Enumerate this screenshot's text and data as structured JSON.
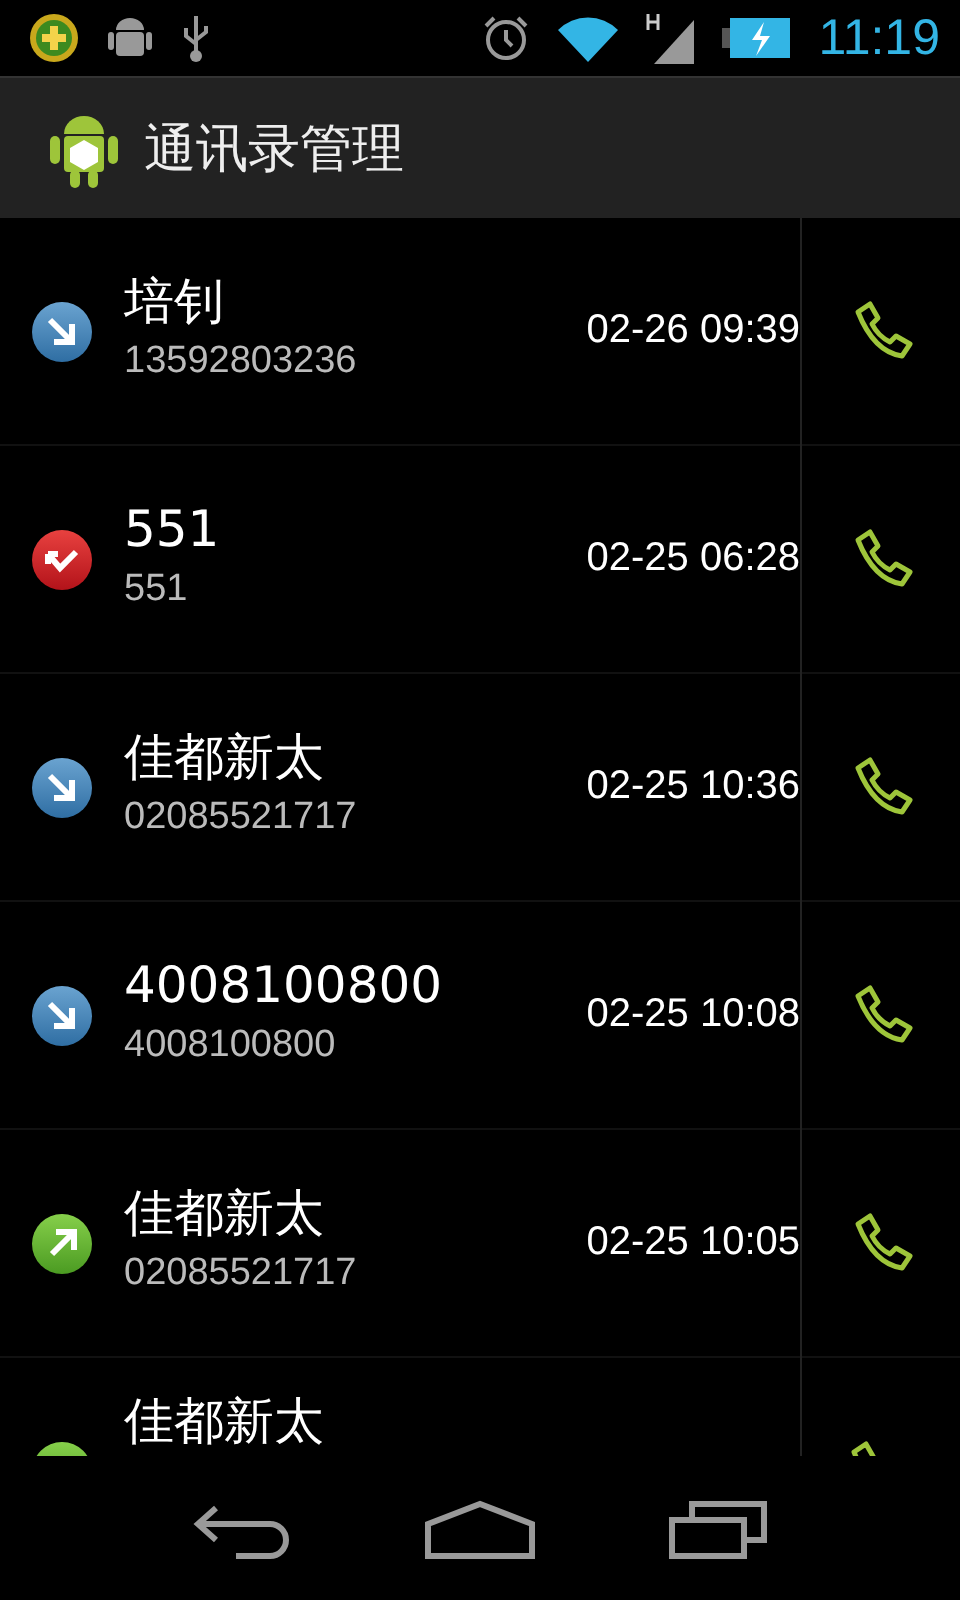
{
  "status_bar": {
    "time": "11:19"
  },
  "action_bar": {
    "title": "通讯录管理"
  },
  "calls": [
    {
      "kind": "incoming",
      "name": "培钊",
      "number": "13592803236",
      "time": "02-26 09:39"
    },
    {
      "kind": "missed",
      "name": "551",
      "number": "551",
      "time": "02-25 06:28"
    },
    {
      "kind": "incoming",
      "name": "佳都新太",
      "number": "02085521717",
      "time": "02-25 10:36"
    },
    {
      "kind": "incoming",
      "name": "4008100800",
      "number": "4008100800",
      "time": "02-25 10:08"
    },
    {
      "kind": "outgoing",
      "name": "佳都新太",
      "number": "02085521717",
      "time": "02-25 10:05"
    },
    {
      "kind": "outgoing",
      "name": "佳都新太"
    }
  ]
}
